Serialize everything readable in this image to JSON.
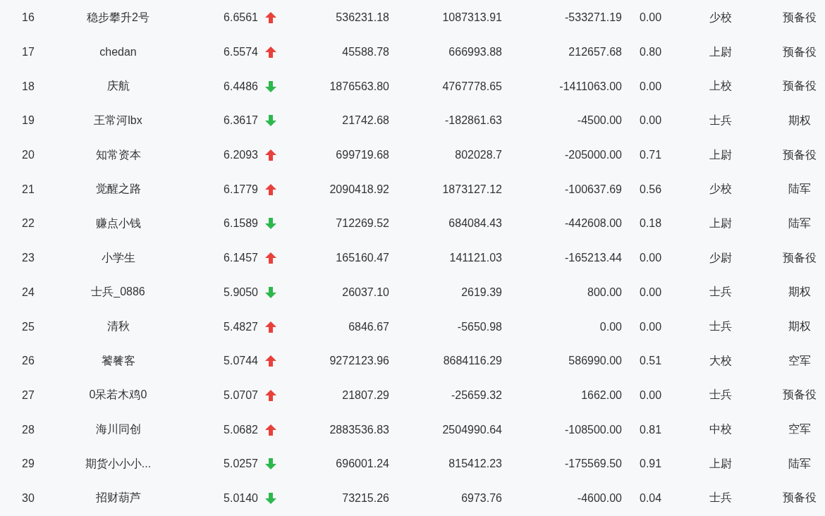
{
  "table": {
    "rows": [
      {
        "column_1": "16",
        "column_2": "稳步攀升2号",
        "column_3": "6.6561",
        "rising": true,
        "column_4": "536231.18",
        "column_5": "1087313.91",
        "column_6": "-533271.19",
        "column_7": "0.00",
        "column_8": "少校",
        "column_9": "预备役"
      },
      {
        "column_1": "17",
        "column_2": "chedan",
        "column_3": "6.5574",
        "rising": true,
        "column_4": "45588.78",
        "column_5": "666993.88",
        "column_6": "212657.68",
        "column_7": "0.80",
        "column_8": "上尉",
        "column_9": "预备役"
      },
      {
        "column_1": "18",
        "column_2": "庆航",
        "column_3": "6.4486",
        "rising": false,
        "column_4": "1876563.80",
        "column_5": "4767778.65",
        "column_6": "-1411063.00",
        "column_7": "0.00",
        "column_8": "上校",
        "column_9": "预备役"
      },
      {
        "column_1": "19",
        "column_2": "王常河lbx",
        "column_3": "6.3617",
        "rising": false,
        "column_4": "21742.68",
        "column_5": "-182861.63",
        "column_6": "-4500.00",
        "column_7": "0.00",
        "column_8": "士兵",
        "column_9": "期权"
      },
      {
        "column_1": "20",
        "column_2": "知常资本",
        "column_3": "6.2093",
        "rising": true,
        "column_4": "699719.68",
        "column_5": "802028.7",
        "column_6": "-205000.00",
        "column_7": "0.71",
        "column_8": "上尉",
        "column_9": "预备役"
      },
      {
        "column_1": "21",
        "column_2": "觉醒之路",
        "column_3": "6.1779",
        "rising": true,
        "column_4": "2090418.92",
        "column_5": "1873127.12",
        "column_6": "-100637.69",
        "column_7": "0.56",
        "column_8": "少校",
        "column_9": "陆军"
      },
      {
        "column_1": "22",
        "column_2": "赚点小钱",
        "column_3": "6.1589",
        "rising": false,
        "column_4": "712269.52",
        "column_5": "684084.43",
        "column_6": "-442608.00",
        "column_7": "0.18",
        "column_8": "上尉",
        "column_9": "陆军"
      },
      {
        "column_1": "23",
        "column_2": "小学生",
        "column_3": "6.1457",
        "rising": true,
        "column_4": "165160.47",
        "column_5": "141121.03",
        "column_6": "-165213.44",
        "column_7": "0.00",
        "column_8": "少尉",
        "column_9": "预备役"
      },
      {
        "column_1": "24",
        "column_2": "士兵_0886",
        "column_3": "5.9050",
        "rising": false,
        "column_4": "26037.10",
        "column_5": "2619.39",
        "column_6": "800.00",
        "column_7": "0.00",
        "column_8": "士兵",
        "column_9": "期权"
      },
      {
        "column_1": "25",
        "column_2": "清秋",
        "column_3": "5.4827",
        "rising": true,
        "column_4": "6846.67",
        "column_5": "-5650.98",
        "column_6": "0.00",
        "column_7": "0.00",
        "column_8": "士兵",
        "column_9": "期权"
      },
      {
        "column_1": "26",
        "column_2": "饕餮客",
        "column_3": "5.0744",
        "rising": true,
        "column_4": "9272123.96",
        "column_5": "8684116.29",
        "column_6": "586990.00",
        "column_7": "0.51",
        "column_8": "大校",
        "column_9": "空军"
      },
      {
        "column_1": "27",
        "column_2": "0呆若木鸡0",
        "column_3": "5.0707",
        "rising": true,
        "column_4": "21807.29",
        "column_5": "-25659.32",
        "column_6": "1662.00",
        "column_7": "0.00",
        "column_8": "士兵",
        "column_9": "预备役"
      },
      {
        "column_1": "28",
        "column_2": "海川同创",
        "column_3": "5.0682",
        "rising": true,
        "column_4": "2883536.83",
        "column_5": "2504990.64",
        "column_6": "-108500.00",
        "column_7": "0.81",
        "column_8": "中校",
        "column_9": "空军"
      },
      {
        "column_1": "29",
        "column_2": "期货小小小...",
        "column_3": "5.0257",
        "rising": false,
        "column_4": "696001.24",
        "column_5": "815412.23",
        "column_6": "-175569.50",
        "column_7": "0.91",
        "column_8": "上尉",
        "column_9": "陆军"
      },
      {
        "column_1": "30",
        "column_2": "招财葫芦",
        "column_3": "5.0140",
        "rising": false,
        "column_4": "73215.26",
        "column_5": "6973.76",
        "column_6": "-4600.00",
        "column_7": "0.04",
        "column_8": "士兵",
        "column_9": "预备役"
      }
    ]
  }
}
